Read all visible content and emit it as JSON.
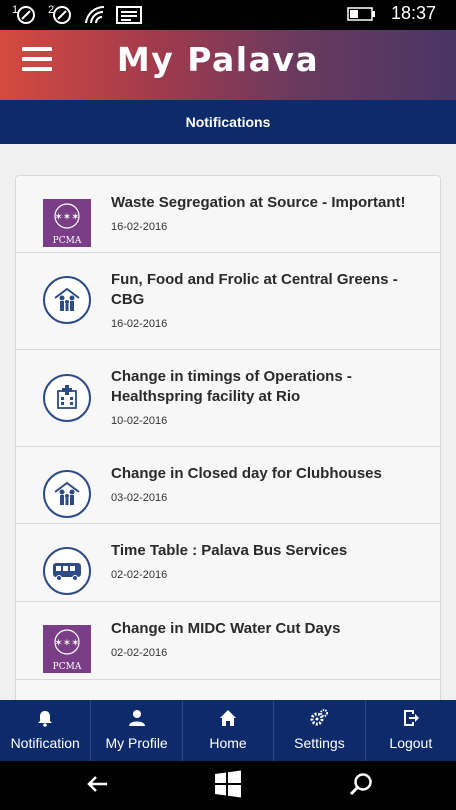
{
  "status": {
    "sim1": "1",
    "sim2": "2",
    "time": "18:37"
  },
  "header": {
    "title": "My Palava",
    "menu_icon": "hamburger-icon"
  },
  "subheader": {
    "title": "Notifications"
  },
  "notifications": [
    {
      "title": "Waste Segregation at Source - Important!",
      "date": "16-02-2016",
      "icon": "pcma-logo",
      "logo_text": "PCMA"
    },
    {
      "title": "Fun, Food and Frolic at Central Greens - CBG",
      "date": "16-02-2016",
      "icon": "family-icon"
    },
    {
      "title": "Change in timings of Operations - Healthspring facility at Rio",
      "date": "10-02-2016",
      "icon": "hospital-icon"
    },
    {
      "title": "Change in Closed day for Clubhouses",
      "date": "03-02-2016",
      "icon": "family-icon"
    },
    {
      "title": "Time Table : Palava Bus Services",
      "date": "02-02-2016",
      "icon": "bus-icon"
    },
    {
      "title": "Change in MIDC Water Cut Days",
      "date": "02-02-2016",
      "icon": "pcma-logo",
      "logo_text": "PCMA"
    }
  ],
  "bottom_nav": [
    {
      "label": "Notification",
      "icon": "bell-icon"
    },
    {
      "label": "My Profile",
      "icon": "user-icon"
    },
    {
      "label": "Home",
      "icon": "home-icon"
    },
    {
      "label": "Settings",
      "icon": "gears-icon"
    },
    {
      "label": "Logout",
      "icon": "logout-icon"
    }
  ],
  "colors": {
    "header_gradient_start": "#d54a3f",
    "header_gradient_end": "#4a3565",
    "navy": "#0d2b6b",
    "pcma_purple": "#7a3e86"
  }
}
